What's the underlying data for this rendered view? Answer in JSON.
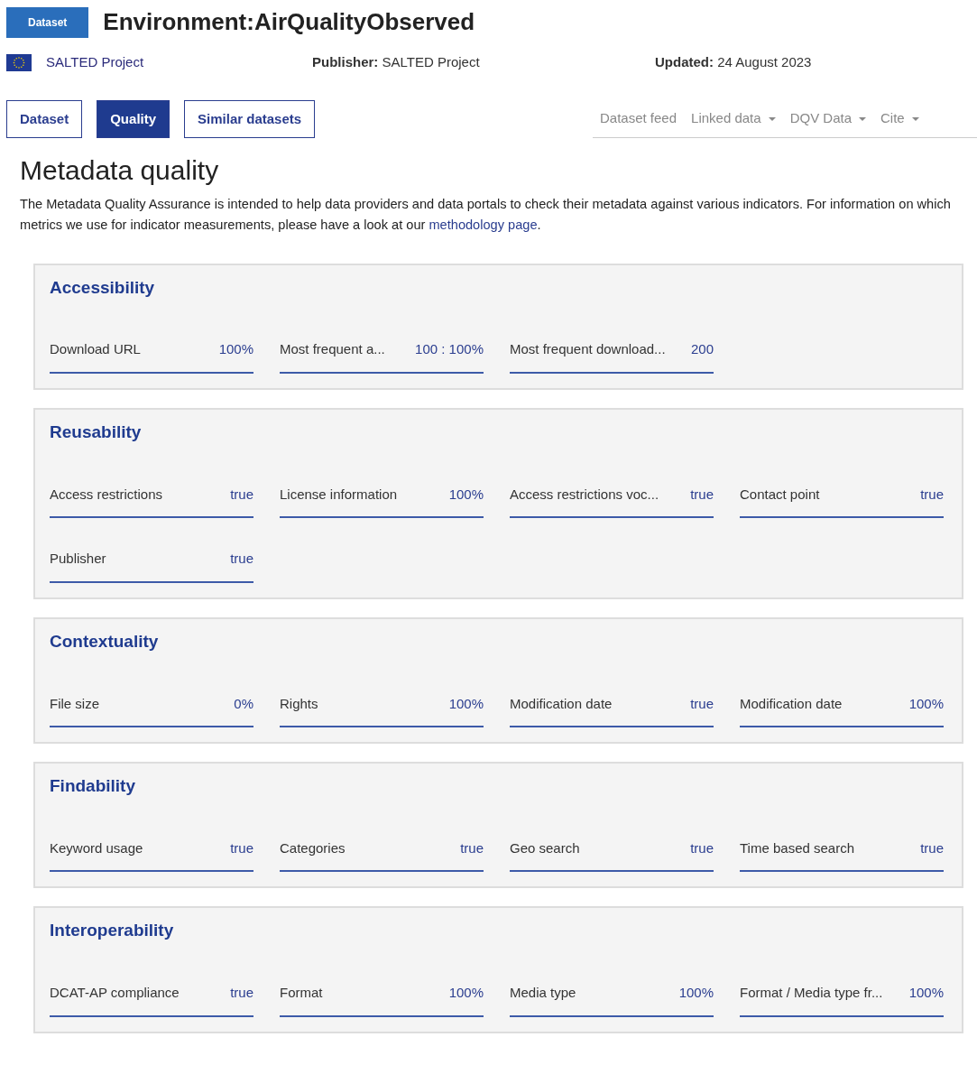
{
  "header": {
    "badge": "Dataset",
    "title": "Environment:AirQualityObserved",
    "catalog": "SALTED Project",
    "publisher_label": "Publisher:",
    "publisher": "SALTED Project",
    "updated_label": "Updated:",
    "updated": "24 August 2023"
  },
  "tabs": [
    {
      "label": "Dataset",
      "selected": false
    },
    {
      "label": "Quality",
      "selected": true
    },
    {
      "label": "Similar datasets",
      "selected": false
    }
  ],
  "actions": [
    {
      "label": "Dataset feed",
      "dropdown": false
    },
    {
      "label": "Linked data",
      "dropdown": true
    },
    {
      "label": "DQV Data",
      "dropdown": true
    },
    {
      "label": "Cite",
      "dropdown": true
    }
  ],
  "heading": "Metadata quality",
  "intro": {
    "text": "The Metadata Quality Assurance is intended to help data providers and data portals to check their metadata against various indicators. For information on which metrics we use for indicator measurements, please have a look at our",
    "link": "methodology page",
    "end": "."
  },
  "sections": [
    {
      "title": "Accessibility",
      "metrics": [
        {
          "label": "Download URL",
          "value": "100%"
        },
        {
          "label": "Most frequent a...",
          "value": "100 : 100%"
        },
        {
          "label": "Most frequent download...",
          "value": "200"
        }
      ]
    },
    {
      "title": "Reusability",
      "metrics": [
        {
          "label": "Access restrictions",
          "value": "true"
        },
        {
          "label": "License information",
          "value": "100%"
        },
        {
          "label": "Access restrictions voc...",
          "value": "true"
        },
        {
          "label": "Contact point",
          "value": "true"
        },
        {
          "label": "Publisher",
          "value": "true"
        }
      ]
    },
    {
      "title": "Contextuality",
      "metrics": [
        {
          "label": "File size",
          "value": "0%"
        },
        {
          "label": "Rights",
          "value": "100%"
        },
        {
          "label": "Modification date",
          "value": "true"
        },
        {
          "label": "Modification date",
          "value": "100%"
        }
      ]
    },
    {
      "title": "Findability",
      "metrics": [
        {
          "label": "Keyword usage",
          "value": "true"
        },
        {
          "label": "Categories",
          "value": "true"
        },
        {
          "label": "Geo search",
          "value": "true"
        },
        {
          "label": "Time based search",
          "value": "true"
        }
      ]
    },
    {
      "title": "Interoperability",
      "metrics": [
        {
          "label": "DCAT-AP compliance",
          "value": "true"
        },
        {
          "label": "Format",
          "value": "100%"
        },
        {
          "label": "Media type",
          "value": "100%"
        },
        {
          "label": "Format / Media type fr...",
          "value": "100%"
        }
      ]
    }
  ]
}
